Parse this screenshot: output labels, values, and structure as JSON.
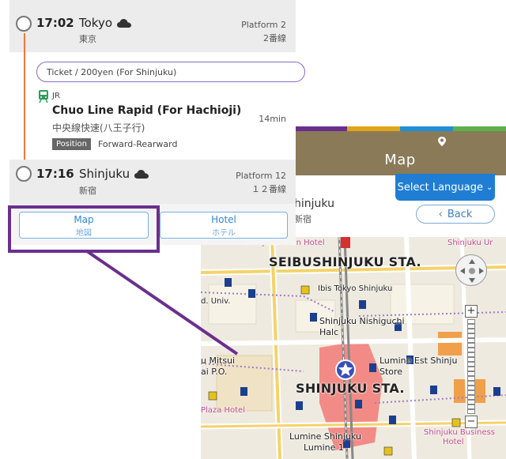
{
  "route": {
    "origin": {
      "time": "17:02",
      "name": "Tokyo",
      "name_jp": "東京",
      "platform": "Platform 2",
      "platform_jp": "2番線",
      "weather_icon": "cloud-icon"
    },
    "ticket": "Ticket / 200yen (For Shinjuku)",
    "segment": {
      "company": "JR",
      "line": "Chuo Line Rapid (For Hachioji)",
      "line_jp": "中央線快速(八王子行)",
      "duration": "14min",
      "position_label": "Position",
      "position_value": "Forward-Rearward",
      "line_color": "#f1783a"
    },
    "destination": {
      "time": "17:16",
      "name": "Shinjuku",
      "name_jp": "新宿",
      "platform": "Platform 12",
      "platform_jp": "１２番線",
      "weather_icon": "cloud-icon"
    }
  },
  "buttons": {
    "map": {
      "label": "Map",
      "label_jp": "地図"
    },
    "hotel": {
      "label": "Hotel",
      "label_jp": "ホテル"
    }
  },
  "highlight_color": "#6a2f8e",
  "map_page": {
    "header_title": "Map",
    "header_icon": "map-pin-icon",
    "color_bar": [
      "#6a2f8e",
      "#e0a418",
      "#1f8fd6",
      "#5bb04a"
    ],
    "select_language": "Select Language",
    "station_name": "Shinjuku",
    "station_name_partial": "hinjuku",
    "station_jp": "新宿",
    "back_label": "Back",
    "map_labels": {
      "seibu": "SEIBUSHINJUKU STA.",
      "shinjuku": "SHINJUKU STA.",
      "ibis": "Ibis Tokyo Shinjuku",
      "nishiguchi_1": "Shinjuku Nishiguchi",
      "nishiguchi_2": "Halc",
      "lumine_est": "Lumine Est Shinju",
      "store": "Store",
      "mitsui": "u Mitsui",
      "mitsui_2": "ai P.O.",
      "univ": "d. Univ.",
      "plaza": "Plaza Hotel",
      "lumine_1": "Lumine Shinjuku",
      "lumine_2": "Lumine 1",
      "town_hotel": "Shinjuku Town Hotel",
      "business_hotel": "Shinjuku Business",
      "hotel": "Hotel",
      "ur": "Shinjuku Ur"
    }
  }
}
